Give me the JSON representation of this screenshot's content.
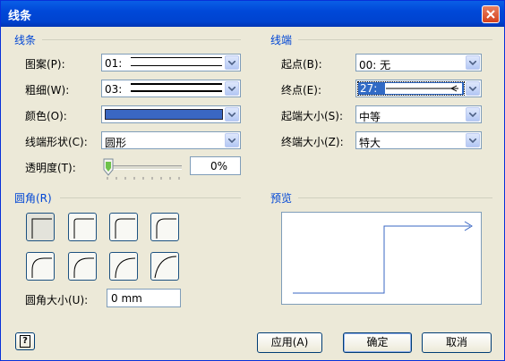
{
  "window": {
    "title": "线条",
    "close_icon": "close-icon"
  },
  "line_section": {
    "heading": "线条",
    "pattern": {
      "label": "图案(P):",
      "value": "01:"
    },
    "weight": {
      "label": "粗细(W):",
      "value": "03:"
    },
    "color": {
      "label": "颜色(O):",
      "swatch_color": "#3a67c3"
    },
    "cap": {
      "label": "线端形状(C):",
      "value": "圆形"
    },
    "transparency": {
      "label": "透明度(T):",
      "value": "0%",
      "level": 0
    }
  },
  "ends_section": {
    "heading": "线端",
    "begin": {
      "label": "起点(B):",
      "value": "00: 无"
    },
    "end": {
      "label": "终点(E):",
      "value": "27:"
    },
    "begin_size": {
      "label": "起端大小(S):",
      "value": "中等"
    },
    "end_size": {
      "label": "终端大小(Z):",
      "value": "特大"
    }
  },
  "corners_section": {
    "heading": "圆角(R)",
    "size": {
      "label": "圆角大小(U):",
      "value": "0 mm"
    }
  },
  "preview_section": {
    "heading": "预览"
  },
  "buttons": {
    "apply": "应用(A)",
    "ok": "确定",
    "cancel": "取消",
    "help_glyph": "?"
  }
}
